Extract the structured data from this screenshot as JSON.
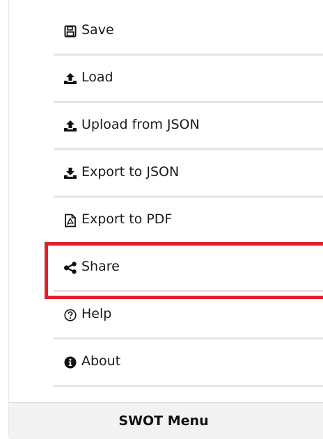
{
  "menu": {
    "items": [
      {
        "label": "Save",
        "icon": "floppy-disk-icon"
      },
      {
        "label": "Load",
        "icon": "upload-icon"
      },
      {
        "label": "Upload from JSON",
        "icon": "upload-icon"
      },
      {
        "label": "Export to JSON",
        "icon": "download-icon"
      },
      {
        "label": "Export to PDF",
        "icon": "pdf-file-icon"
      },
      {
        "label": "Share",
        "icon": "share-icon"
      },
      {
        "label": "Help",
        "icon": "question-circle-icon"
      },
      {
        "label": "About",
        "icon": "info-circle-icon"
      }
    ]
  },
  "footer": {
    "title": "SWOT Menu"
  },
  "colors": {
    "highlight": "#e0202b",
    "divider": "#e3e3e3",
    "footer_bg": "#f2f2f2"
  }
}
